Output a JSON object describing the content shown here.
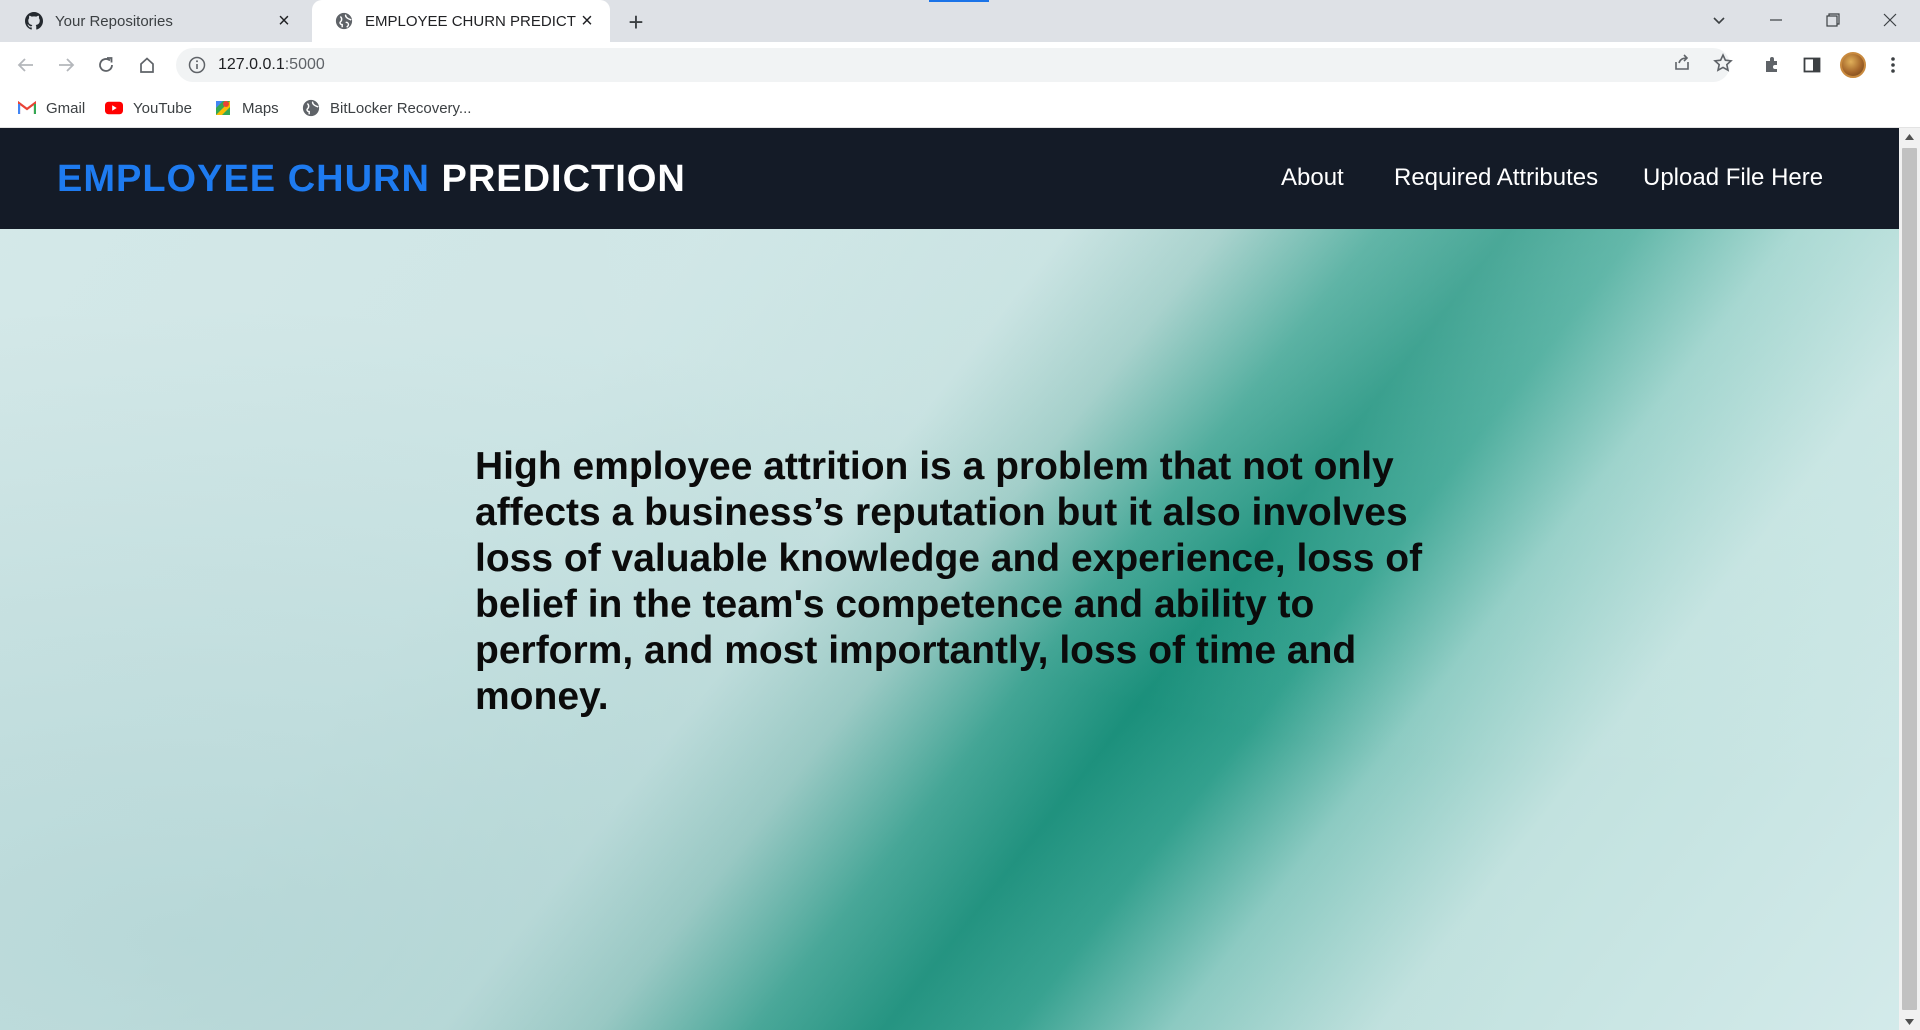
{
  "browser": {
    "tabs": [
      {
        "title": "Your Repositories",
        "icon": "github-icon",
        "active": false
      },
      {
        "title": "EMPLOYEE CHURN PREDICTION",
        "icon": "globe-icon",
        "active": true
      }
    ],
    "new_tab_label": "+",
    "address": {
      "host": "127.0.0.1",
      "port": ":5000"
    },
    "bookmarks": [
      {
        "label": "Gmail",
        "icon": "gmail-icon"
      },
      {
        "label": "YouTube",
        "icon": "youtube-icon"
      },
      {
        "label": "Maps",
        "icon": "maps-icon"
      },
      {
        "label": "BitLocker Recovery...",
        "icon": "globe-icon"
      }
    ],
    "accent_color": "#1a73e8"
  },
  "site": {
    "brand_part1": "EMPLOYEE CHURN",
    "brand_part2": "PREDICTION",
    "brand_color": "#1e7bf0",
    "nav_bg": "#141b27",
    "nav_links": [
      "About",
      "Required Attributes",
      "Upload File Here"
    ],
    "hero_text": "High employee attrition is a problem that not only affects a business’s reputation but it also involves loss of valuable knowledge and experience, loss of belief in the team's competence and ability to perform, and most importantly, loss of time and money."
  }
}
